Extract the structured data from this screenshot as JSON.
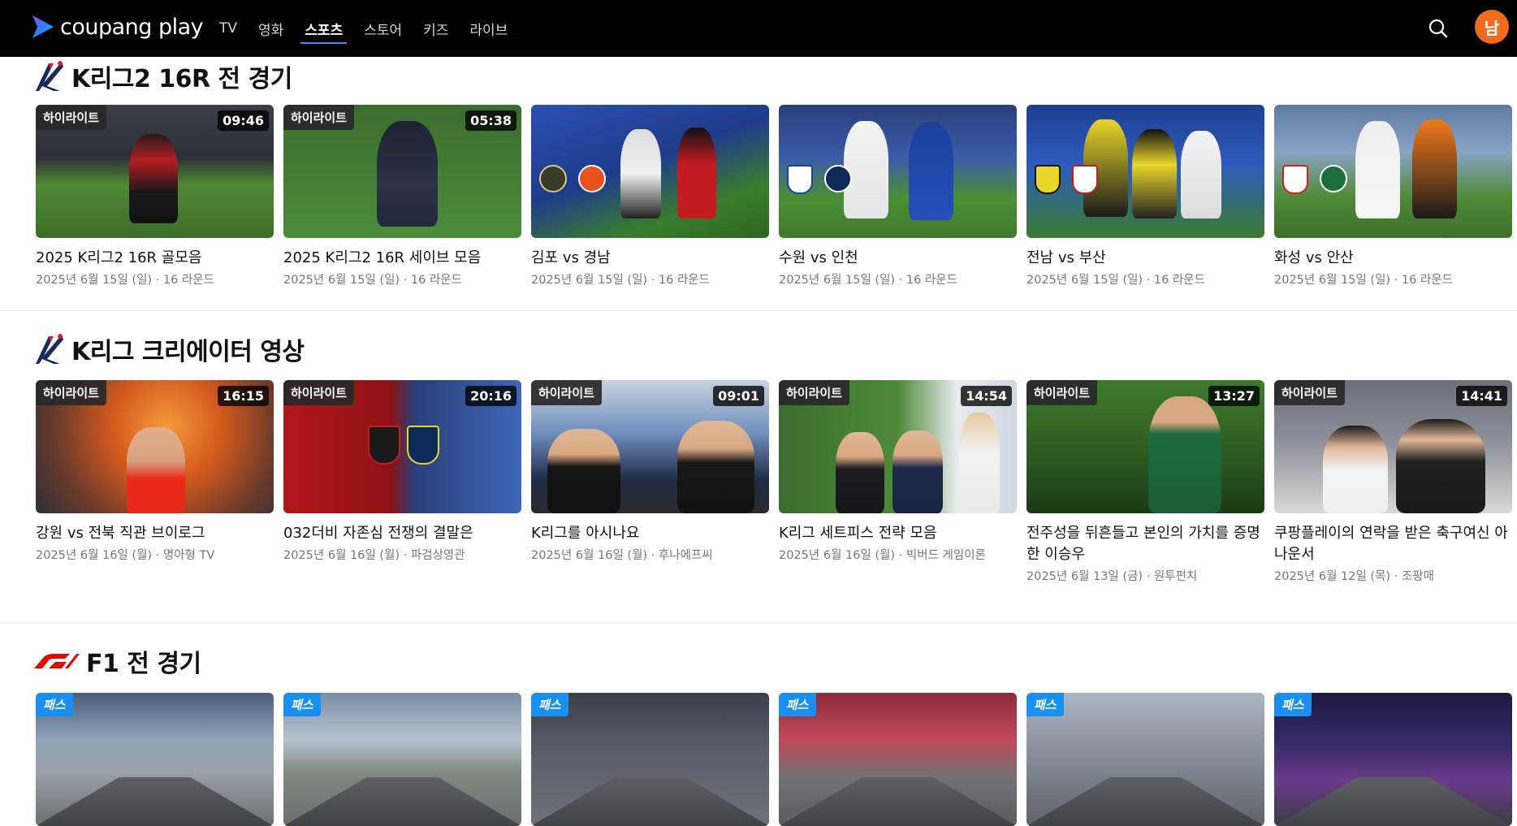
{
  "header": {
    "logo_text": "coupang play",
    "nav": [
      {
        "label": "TV",
        "active": false
      },
      {
        "label": "영화",
        "active": false
      },
      {
        "label": "스포츠",
        "active": true
      },
      {
        "label": "스토어",
        "active": false
      },
      {
        "label": "키즈",
        "active": false
      },
      {
        "label": "라이브",
        "active": false
      }
    ],
    "avatar_text": "남",
    "icons": {
      "search": "search-icon",
      "logo": "play-triangle-logo-icon"
    }
  },
  "sections": [
    {
      "title": "K리그2 16R 전 경기",
      "icon": "k-league-logo-icon",
      "cards": [
        {
          "badge": "하이라이트",
          "duration": "09:46",
          "title": "2025 K리그2 16R 골모음",
          "meta": "2025년 6월 15일 (일) · 16 라운드"
        },
        {
          "badge": "하이라이트",
          "duration": "05:38",
          "title": "2025 K리그2 16R 세이브 모음",
          "meta": "2025년 6월 15일 (일) · 16 라운드"
        },
        {
          "badge": "",
          "duration": "",
          "title": "김포 vs 경남",
          "meta": "2025년 6월 15일 (일) · 16 라운드"
        },
        {
          "badge": "",
          "duration": "",
          "title": "수원 vs 인천",
          "meta": "2025년 6월 15일 (일) · 16 라운드"
        },
        {
          "badge": "",
          "duration": "",
          "title": "전남 vs 부산",
          "meta": "2025년 6월 15일 (일) · 16 라운드"
        },
        {
          "badge": "",
          "duration": "",
          "title": "화성 vs 안산",
          "meta": "2025년 6월 15일 (일) · 16 라운드"
        }
      ]
    },
    {
      "title": "K리그 크리에이터 영상",
      "icon": "k-league-logo-icon",
      "cards": [
        {
          "badge": "하이라이트",
          "duration": "16:15",
          "title": "강원 vs 전북 직관 브이로그",
          "meta": "2025년 6월 16일 (월) · 명아형 TV"
        },
        {
          "badge": "하이라이트",
          "duration": "20:16",
          "title": "032더비 자존심 전쟁의 결말은",
          "meta": "2025년 6월 16일 (월) · 파검상영관"
        },
        {
          "badge": "하이라이트",
          "duration": "09:01",
          "title": "K리그를 아시나요",
          "meta": "2025년 6월 16일 (월) · 후나에프씨"
        },
        {
          "badge": "하이라이트",
          "duration": "14:54",
          "title": "K리그 세트피스 전략 모음",
          "meta": "2025년 6월 16일 (월) · 빅버드 게임이론"
        },
        {
          "badge": "하이라이트",
          "duration": "13:27",
          "title": "전주성을 뒤흔들고 본인의 가치를 증명한 이승우",
          "meta": "2025년 6월 13일 (금) · 원투펀치"
        },
        {
          "badge": "하이라이트",
          "duration": "14:41",
          "title": "쿠팡플레이의 연락을 받은 축구여신 아나운서",
          "meta": "2025년 6월 12일 (목) · 조팡매"
        }
      ]
    },
    {
      "title": "F1 전 경기",
      "icon": "f1-logo-icon",
      "cards": [
        {
          "badge": "패스"
        },
        {
          "badge": "패스"
        },
        {
          "badge": "패스"
        },
        {
          "badge": "패스"
        },
        {
          "badge": "패스"
        },
        {
          "badge": "패스"
        }
      ]
    }
  ]
}
